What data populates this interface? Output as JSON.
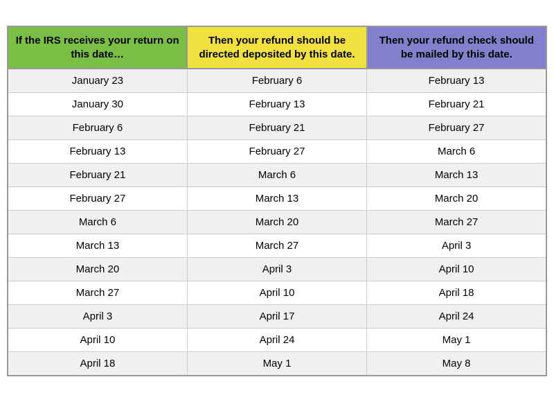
{
  "header": {
    "col1": "If the IRS receives your return on this date…",
    "col2": "Then your refund should be directed deposited by this date.",
    "col3": "Then your refund check should be mailed by this date."
  },
  "rows": [
    {
      "col1": "January 23",
      "col2": "February 6",
      "col3": "February 13"
    },
    {
      "col1": "January 30",
      "col2": "February 13",
      "col3": "February 21"
    },
    {
      "col1": "February 6",
      "col2": "February 21",
      "col3": "February 27"
    },
    {
      "col1": "February 13",
      "col2": "February 27",
      "col3": "March 6"
    },
    {
      "col1": "February 21",
      "col2": "March 6",
      "col3": "March 13"
    },
    {
      "col1": "February 27",
      "col2": "March 13",
      "col3": "March 20"
    },
    {
      "col1": "March 6",
      "col2": "March 20",
      "col3": "March 27"
    },
    {
      "col1": "March 13",
      "col2": "March 27",
      "col3": "April 3"
    },
    {
      "col1": "March 20",
      "col2": "April 3",
      "col3": "April 10"
    },
    {
      "col1": "March 27",
      "col2": "April 10",
      "col3": "April 18"
    },
    {
      "col1": "April 3",
      "col2": "April 17",
      "col3": "April 24"
    },
    {
      "col1": "April 10",
      "col2": "April 24",
      "col3": "May 1"
    },
    {
      "col1": "April 18",
      "col2": "May 1",
      "col3": "May 8"
    }
  ]
}
